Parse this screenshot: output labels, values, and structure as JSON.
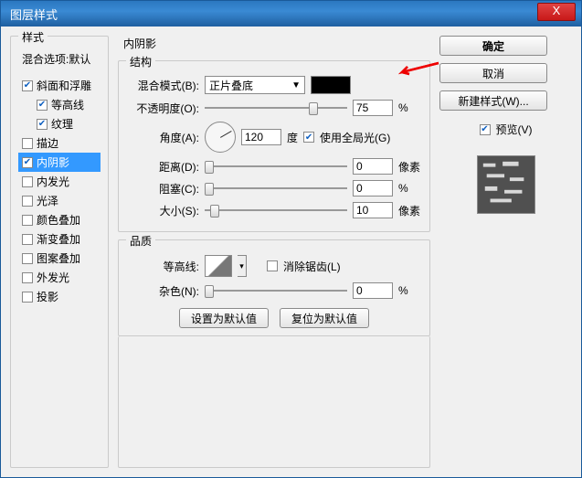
{
  "window": {
    "title": "图层样式",
    "close": "X"
  },
  "styles": {
    "header": "样式",
    "blend_options": "混合选项:默认",
    "items": [
      {
        "label": "斜面和浮雕",
        "checked": true,
        "indent": 0
      },
      {
        "label": "等高线",
        "checked": true,
        "indent": 1
      },
      {
        "label": "纹理",
        "checked": true,
        "indent": 1
      },
      {
        "label": "描边",
        "checked": false,
        "indent": 0
      },
      {
        "label": "内阴影",
        "checked": true,
        "indent": 0,
        "selected": true
      },
      {
        "label": "内发光",
        "checked": false,
        "indent": 0
      },
      {
        "label": "光泽",
        "checked": false,
        "indent": 0
      },
      {
        "label": "颜色叠加",
        "checked": false,
        "indent": 0
      },
      {
        "label": "渐变叠加",
        "checked": false,
        "indent": 0
      },
      {
        "label": "图案叠加",
        "checked": false,
        "indent": 0
      },
      {
        "label": "外发光",
        "checked": false,
        "indent": 0
      },
      {
        "label": "投影",
        "checked": false,
        "indent": 0
      }
    ]
  },
  "panel": {
    "title": "内阴影",
    "structure_title": "结构",
    "blend_mode_label": "混合模式(B):",
    "blend_mode_value": "正片叠底",
    "color": "#000000",
    "opacity_label": "不透明度(O):",
    "opacity_value": "75",
    "opacity_unit": "%",
    "angle_label": "角度(A):",
    "angle_value": "120",
    "angle_unit": "度",
    "global_light_label": "使用全局光(G)",
    "global_light_checked": true,
    "distance_label": "距离(D):",
    "distance_value": "0",
    "distance_unit": "像素",
    "choke_label": "阻塞(C):",
    "choke_value": "0",
    "choke_unit": "%",
    "size_label": "大小(S):",
    "size_value": "10",
    "size_unit": "像素",
    "quality_title": "品质",
    "contour_label": "等高线:",
    "antialias_label": "消除锯齿(L)",
    "antialias_checked": false,
    "noise_label": "杂色(N):",
    "noise_value": "0",
    "noise_unit": "%",
    "make_default": "设置为默认值",
    "reset_default": "复位为默认值"
  },
  "right": {
    "ok": "确定",
    "cancel": "取消",
    "new_style": "新建样式(W)...",
    "preview_label": "预览(V)",
    "preview_checked": true
  }
}
